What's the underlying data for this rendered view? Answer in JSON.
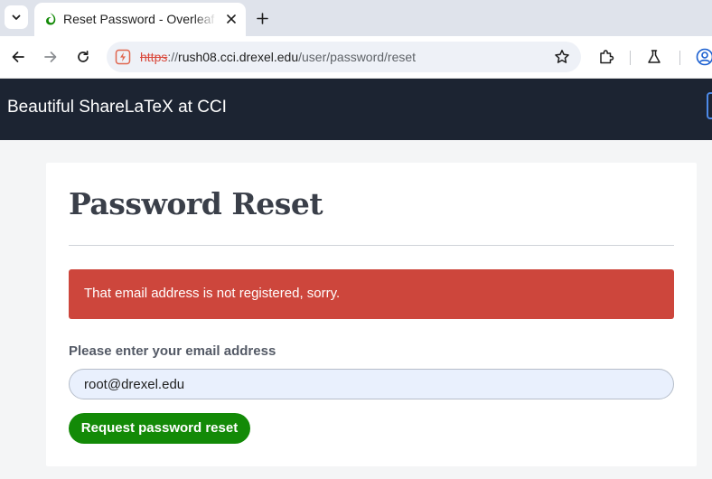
{
  "browser": {
    "tab": {
      "title": "Reset Password - Overleaf"
    },
    "address_bar": {
      "scheme": "https",
      "separator": "://",
      "host": "rush08.cci.drexel.edu",
      "path": "/user/password/reset"
    }
  },
  "site": {
    "brand": "Beautiful ShareLaTeX at CCI"
  },
  "page": {
    "title": "Password Reset",
    "alert": {
      "message": "That email address is not registered, sorry."
    },
    "form": {
      "email_label": "Please enter your email address",
      "email_value": "root@drexel.edu",
      "submit_label": "Request password reset"
    }
  },
  "colors": {
    "header_background": "#1c2432",
    "alert_background": "#cd463c",
    "primary_button": "#138a07",
    "insecure_scheme": "#d9483b"
  },
  "icons": {
    "tab_favicon": "overleaf-leaf-icon",
    "site_info": "not-secure-warning-icon",
    "bookmark": "star-icon",
    "extensions": "puzzle-piece-icon",
    "labs": "flask-icon",
    "profile": "profile-icon"
  }
}
